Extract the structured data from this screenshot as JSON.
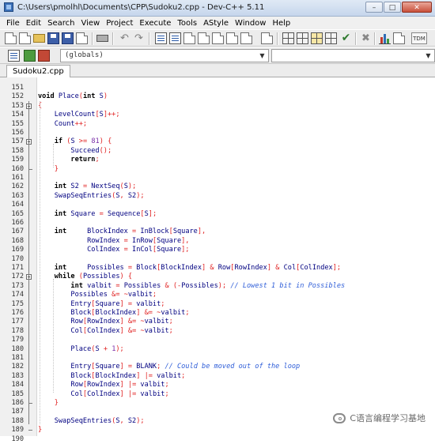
{
  "window": {
    "title": "C:\\Users\\pmolhl\\Documents\\CPP\\Sudoku2.cpp - Dev-C++ 5.11",
    "min_glyph": "–",
    "max_glyph": "□",
    "close_glyph": "✕"
  },
  "menu": [
    {
      "label": "File"
    },
    {
      "label": "Edit"
    },
    {
      "label": "Search"
    },
    {
      "label": "View"
    },
    {
      "label": "Project"
    },
    {
      "label": "Execute"
    },
    {
      "label": "Tools"
    },
    {
      "label": "AStyle"
    },
    {
      "label": "Window"
    },
    {
      "label": "Help"
    }
  ],
  "toolbar": {
    "undo_glyph": "↶",
    "redo_glyph": "↷",
    "check_glyph": "✔",
    "x_glyph": "✖",
    "tdm_label": "TDM",
    "combo_scope": "(globals)",
    "combo_arrow": "▼"
  },
  "tabs": [
    {
      "label": "Sudoku2.cpp",
      "active": true
    }
  ],
  "editor": {
    "lines": [
      {
        "n": "151",
        "text": ""
      },
      {
        "n": "152",
        "text": "void Place(int S)"
      },
      {
        "n": "153",
        "text": "{"
      },
      {
        "n": "154",
        "text": "    LevelCount[S]++;"
      },
      {
        "n": "155",
        "text": "    Count++;"
      },
      {
        "n": "156",
        "text": ""
      },
      {
        "n": "157",
        "text": "    if (S >= 81) {"
      },
      {
        "n": "158",
        "text": "        Succeed();"
      },
      {
        "n": "159",
        "text": "        return;"
      },
      {
        "n": "160",
        "text": "    }"
      },
      {
        "n": "161",
        "text": ""
      },
      {
        "n": "162",
        "text": "    int S2 = NextSeq(S);"
      },
      {
        "n": "163",
        "text": "    SwapSeqEntries(S, S2);"
      },
      {
        "n": "164",
        "text": ""
      },
      {
        "n": "165",
        "text": "    int Square = Sequence[S];"
      },
      {
        "n": "166",
        "text": ""
      },
      {
        "n": "167",
        "text": "    int     BlockIndex = InBlock[Square],"
      },
      {
        "n": "168",
        "text": "            RowIndex = InRow[Square],"
      },
      {
        "n": "169",
        "text": "            ColIndex = InCol[Square];"
      },
      {
        "n": "170",
        "text": ""
      },
      {
        "n": "171",
        "text": "    int     Possibles = Block[BlockIndex] & Row[RowIndex] & Col[ColIndex];"
      },
      {
        "n": "172",
        "text": "    while (Possibles) {"
      },
      {
        "n": "173",
        "text": "        int valbit = Possibles & (-Possibles); // Lowest 1 bit in Possibles"
      },
      {
        "n": "174",
        "text": "        Possibles &= ~valbit;"
      },
      {
        "n": "175",
        "text": "        Entry[Square] = valbit;"
      },
      {
        "n": "176",
        "text": "        Block[BlockIndex] &= ~valbit;"
      },
      {
        "n": "177",
        "text": "        Row[RowIndex] &= ~valbit;"
      },
      {
        "n": "178",
        "text": "        Col[ColIndex] &= ~valbit;"
      },
      {
        "n": "179",
        "text": ""
      },
      {
        "n": "180",
        "text": "        Place(S + 1);"
      },
      {
        "n": "181",
        "text": ""
      },
      {
        "n": "182",
        "text": "        Entry[Square] = BLANK; // Could be moved out of the loop"
      },
      {
        "n": "183",
        "text": "        Block[BlockIndex] |= valbit;"
      },
      {
        "n": "184",
        "text": "        Row[RowIndex] |= valbit;"
      },
      {
        "n": "185",
        "text": "        Col[ColIndex] |= valbit;"
      },
      {
        "n": "186",
        "text": "    }"
      },
      {
        "n": "187",
        "text": ""
      },
      {
        "n": "188",
        "text": "    SwapSeqEntries(S, S2);"
      },
      {
        "n": "189",
        "text": "}"
      },
      {
        "n": "190",
        "text": ""
      }
    ]
  },
  "watermark": {
    "text": "C语言编程学习基地"
  }
}
